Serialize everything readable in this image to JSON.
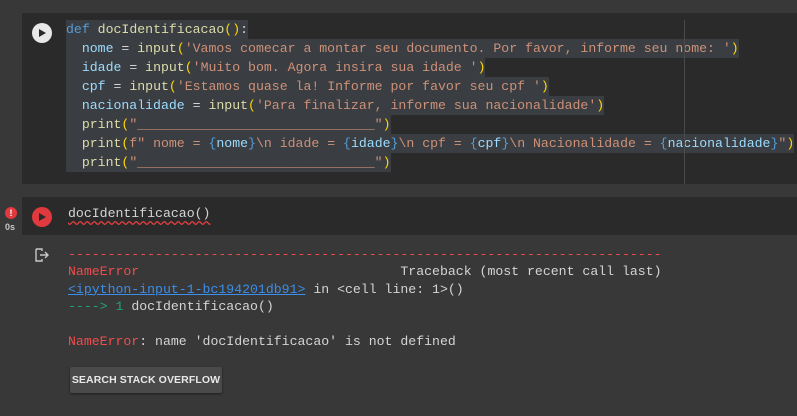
{
  "cell1": {
    "lines": [
      "def docIdentificacao():",
      "  nome = input('Vamos comecar a montar seu documento. Por favor, informe seu nome: ')",
      "  idade = input('Muito bom. Agora insira sua idade ')",
      "  cpf = input('Estamos quase la! Informe por favor seu cpf ')",
      "  nacionalidade = input('Para finalizar, informe sua nacionalidade')",
      "  print(\"______________________________\")",
      "  print(f\" nome = {nome}\\n idade = {idade}\\n cpf = {cpf}\\n Nacionalidade = {nacionalidade}\")",
      "  print(\"______________________________\")"
    ]
  },
  "cell2": {
    "code": "docIdentificacao()",
    "error_badge": "!",
    "exec_time": "0s"
  },
  "output": {
    "dashes": "---------------------------------------------------------------------------",
    "error_name": "NameError",
    "traceback_label": "Traceback (most recent call last)",
    "input_link": "<ipython-input-1-bc194201db91>",
    "in_cell": " in <cell line: 1>()",
    "arrow": "----> 1",
    "arrow_code": " docIdentificacao()",
    "error_msg_name": "NameError",
    "error_msg": ": name 'docIdentificacao' is not defined",
    "button_label": "SEARCH STACK OVERFLOW"
  }
}
